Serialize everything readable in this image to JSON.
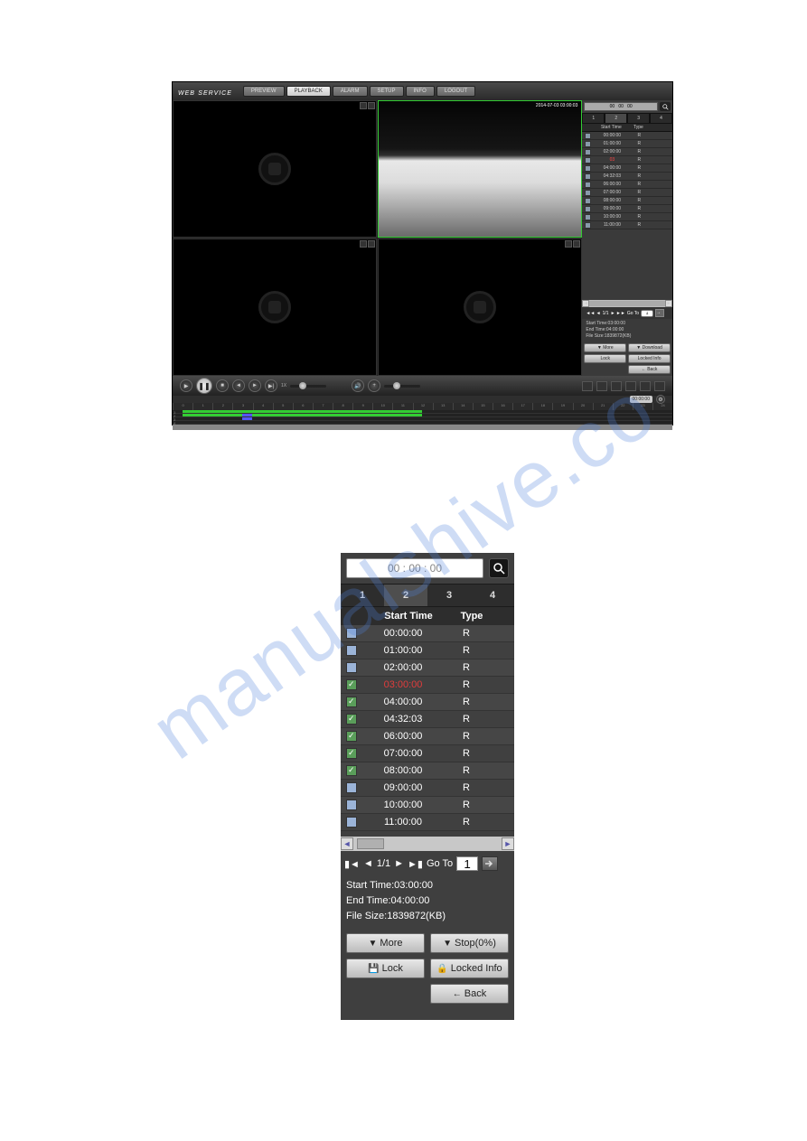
{
  "watermark": "manualshive.co",
  "fig1": {
    "logo": "WEB",
    "logo_sub": "SERVICE",
    "tabs": [
      "PREVIEW",
      "PLAYBACK",
      "ALARM",
      "SETUP",
      "INFO",
      "LOGOUT"
    ],
    "active_tab": 1,
    "timestamp": "2014-07-03 03:00:03",
    "search_value": "00   00   00",
    "ch_tabs": [
      "1",
      "2",
      "3",
      "4"
    ],
    "ch_active": 1,
    "thead": {
      "start": "Start Time",
      "type": "Type"
    },
    "rows": [
      {
        "t": "00:00:00",
        "y": "R",
        "ck": false,
        "red": false
      },
      {
        "t": "01:00:00",
        "y": "R",
        "ck": false,
        "red": false
      },
      {
        "t": "02:00:00",
        "y": "R",
        "ck": false,
        "red": false
      },
      {
        "t": "03",
        "y": "R",
        "ck": false,
        "red": true
      },
      {
        "t": "04:00:00",
        "y": "R",
        "ck": false,
        "red": false
      },
      {
        "t": "04:32:03",
        "y": "R",
        "ck": false,
        "red": false
      },
      {
        "t": "06:00:00",
        "y": "R",
        "ck": false,
        "red": false
      },
      {
        "t": "07:00:00",
        "y": "R",
        "ck": false,
        "red": false
      },
      {
        "t": "08:00:00",
        "y": "R",
        "ck": false,
        "red": false
      },
      {
        "t": "09:00:00",
        "y": "R",
        "ck": false,
        "red": false
      },
      {
        "t": "10:00:00",
        "y": "R",
        "ck": false,
        "red": false
      },
      {
        "t": "11:00:00",
        "y": "R",
        "ck": false,
        "red": false
      }
    ],
    "nav": {
      "prefix": "◄◄ ◄",
      "pages": "1/1",
      "suffix": "► ►►",
      "goto": "Go To",
      "page": "1"
    },
    "info": {
      "l1": "Start Time:03:00:00",
      "l2": "End Time:04:00:00",
      "l3": "File Size:1839872(KB)"
    },
    "btns": {
      "more": "More",
      "download": "Download",
      "lock": "Lock",
      "locked": "Locked Info",
      "back": "Back"
    },
    "speed": "1X",
    "timecode": "00:00:00",
    "ruler": [
      "0",
      "1",
      "2",
      "3",
      "4",
      "5",
      "6",
      "7",
      "8",
      "9",
      "10",
      "11",
      "12",
      "13",
      "14",
      "15",
      "16",
      "17",
      "18",
      "19",
      "20",
      "21",
      "22",
      "23",
      "24"
    ]
  },
  "fig2": {
    "search_value": "00 : 00  :  00",
    "ch_tabs": [
      "1",
      "2",
      "3",
      "4"
    ],
    "ch_active": 1,
    "thead": {
      "start": "Start Time",
      "type": "Type"
    },
    "rows": [
      {
        "t": "00:00:00",
        "y": "R",
        "ck": false,
        "red": false
      },
      {
        "t": "01:00:00",
        "y": "R",
        "ck": false,
        "red": false
      },
      {
        "t": "02:00:00",
        "y": "R",
        "ck": false,
        "red": false
      },
      {
        "t": "03:00:00",
        "y": "R",
        "ck": true,
        "red": true
      },
      {
        "t": "04:00:00",
        "y": "R",
        "ck": true,
        "red": false
      },
      {
        "t": "04:32:03",
        "y": "R",
        "ck": true,
        "red": false
      },
      {
        "t": "06:00:00",
        "y": "R",
        "ck": true,
        "red": false
      },
      {
        "t": "07:00:00",
        "y": "R",
        "ck": true,
        "red": false
      },
      {
        "t": "08:00:00",
        "y": "R",
        "ck": true,
        "red": false
      },
      {
        "t": "09:00:00",
        "y": "R",
        "ck": false,
        "red": false
      },
      {
        "t": "10:00:00",
        "y": "R",
        "ck": false,
        "red": false
      },
      {
        "t": "11:00:00",
        "y": "R",
        "ck": false,
        "red": false
      }
    ],
    "nav": {
      "first": "▮◄",
      "prev": "◄",
      "pages": "1/1",
      "next": "►",
      "last": "►▮",
      "goto": "Go To",
      "page": "1"
    },
    "info": {
      "l1": "Start Time:03:00:00",
      "l2": "End Time:04:00:00",
      "l3": "File Size:1839872(KB)"
    },
    "btns": {
      "more": "More",
      "stop": "Stop(0%)",
      "lock": "Lock",
      "locked": "Locked Info",
      "back": "Back"
    }
  }
}
